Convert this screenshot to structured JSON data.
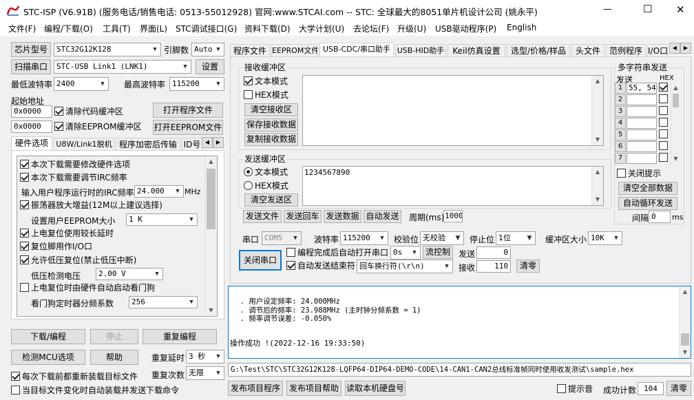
{
  "window": {
    "title": "STC-ISP (V6.91B) (服务电话/销售电话: 0513-55012928) 官网:www.STCAI.com  -- STC: 全球最大的8051单片机设计公司 (姚永平)",
    "minimize": "—",
    "maximize": "☐",
    "close": "✕"
  },
  "menu": [
    "文件(F)",
    "编程/下载(O)",
    "工具(T)",
    "界面(L)",
    "STC调试接口(G)",
    "资料下载(D)",
    "大学计划(U)",
    "去论坛(F)",
    "升级(U)",
    "USB驱动程序(P)",
    "English"
  ],
  "left": {
    "chip_label": "芯片型号",
    "chip_value": "STC32G12K128",
    "pin_label": "引脚数",
    "pin_value": "Auto",
    "scan_label": "扫描串口",
    "port_value": "STC-USB Link1 (LNK1)",
    "settings_label": "设置",
    "min_baud_label": "最低波特率",
    "min_baud_value": "2400",
    "max_baud_label": "最高波特率",
    "max_baud_value": "115200",
    "start_addr_label": "起始地址",
    "addr1": "0x0000",
    "clear_code_label": "清除代码缓冲区",
    "open_prog_label": "打开程序文件",
    "addr2": "0x0000",
    "clear_eeprom_label": "清除EEPROM缓冲区",
    "open_eeprom_label": "打开EEPROM文件",
    "tabs": [
      "硬件选项",
      "U8W/Link1脱机",
      "程序加密后传输",
      "ID号"
    ],
    "options": [
      {
        "label": "本次下载需要修改硬件选项",
        "checked": true
      },
      {
        "label": "本次下载需要调节IRC频率",
        "checked": true
      }
    ],
    "irc_label": "输入用户程序运行时的IRC频率",
    "irc_value": "24.000",
    "irc_unit": "MHz",
    "osc_label": "振荡器放大增益(12M以上建议选择)",
    "eeprom_size_label": "设置用户EEPROM大小",
    "eeprom_size_value": "1    K",
    "power_reset_label": "上电复位使用较长延时",
    "reset_pin_label": "复位脚用作I/O口",
    "lvd_label": "允许低压复位(禁止低压中断)",
    "lvd_volt_label": "低压检测电压",
    "lvd_volt_value": "2.00 V",
    "wdt_label": "上电复位时由硬件自动启动看门狗",
    "wdt_div_label": "看门狗定时器分频系数",
    "wdt_div_value": "256",
    "download_label": "下载/编程",
    "stop_label": "停止",
    "reprogram_label": "重复编程",
    "detect_label": "检测MCU选项",
    "help_label": "帮助",
    "repeat_delay_label": "重复延时",
    "repeat_delay_value": "3 秒",
    "repeat_count_label": "重复次数",
    "repeat_count_value": "无限",
    "reload_label": "每次下载前都重新装载目标文件",
    "auto_load_label": "当目标文件变化时自动装载并发送下载命令"
  },
  "right": {
    "tabs": [
      "程序文件",
      "EEPROM文件",
      "USB-CDC/串口助手",
      "USB-HID助手",
      "Keil仿真设置",
      "选型/价格/样品",
      "头文件",
      "范例程序",
      "I/O口"
    ],
    "rx_group": "接收缓冲区",
    "rx_text_mode": "文本模式",
    "rx_hex_mode": "HEX模式",
    "clear_rx": "清空接收区",
    "save_rx": "保存接收数据",
    "copy_rx": "复制接收数据",
    "tx_group": "发送缓冲区",
    "tx_text_mode": "文本模式",
    "tx_hex_mode": "HEX模式",
    "clear_tx": "清空发送区",
    "tx_content": "1234567890",
    "send_file": "发送文件",
    "send_enter": "发送回车",
    "send_data": "发送数据",
    "auto_send": "自动发送",
    "period_label": "周期(ms)",
    "period_value": "1000",
    "port_label": "串口",
    "port_value": "COM5",
    "baud_label": "波特率",
    "baud_value": "115200",
    "parity_label": "校验位",
    "parity_value": "无校验",
    "stop_label": "停止位",
    "stop_value": "1位",
    "buf_label": "缓冲区大小",
    "buf_value": "10K",
    "close_port": "关闭串口",
    "auto_open_label": "编程完成后自动打开串口",
    "delay_value": "0s",
    "flow_label": "流控制",
    "send_count_label": "发送",
    "send_count": "0",
    "auto_end_label": "自动发送结束符",
    "line_end_value": "回车换行符(\\r\\n)",
    "recv_count_label": "接收",
    "recv_count": "110",
    "clear_count": "清零",
    "multi_title": "多字符串发送",
    "multi_send": "发送",
    "multi_hex": "HEX",
    "multi_rows": [
      {
        "n": "1",
        "v": "55, 54",
        "hex": true
      },
      {
        "n": "2",
        "v": "",
        "hex": false
      },
      {
        "n": "3",
        "v": "",
        "hex": false
      },
      {
        "n": "4",
        "v": "",
        "hex": false
      },
      {
        "n": "5",
        "v": "",
        "hex": false
      },
      {
        "n": "6",
        "v": "",
        "hex": false
      },
      {
        "n": "7",
        "v": "",
        "hex": false
      }
    ],
    "close_tip": "关闭提示",
    "clear_all": "清空全部数据",
    "auto_loop": "自动循环发送",
    "interval_label": "间隔",
    "interval_value": "0",
    "interval_unit": "ms"
  },
  "log": {
    "lines": [
      "  . 用户设定频率: 24.000MHz",
      "  . 调节后的频率: 23.988MHz (主时钟分频系数 = 1)",
      "  . 频率调节误差: -0.050%",
      "",
      "操作成功 !(2022-12-16 19:33:50)"
    ]
  },
  "bottom": {
    "path": "G:\\Test\\STC\\STC32G12K128-LQFP64-DIP64-DEMO-CODE\\14-CAN1-CAN2总线标准帧同时使用收发测试\\sample.hex",
    "publish_prog": "发布项目程序",
    "publish_help": "发布项目帮助",
    "read_disk": "读取本机硬盘号",
    "tip_sound": "提示音",
    "success_label": "成功计数",
    "success_count": "104",
    "clear": "清零"
  }
}
